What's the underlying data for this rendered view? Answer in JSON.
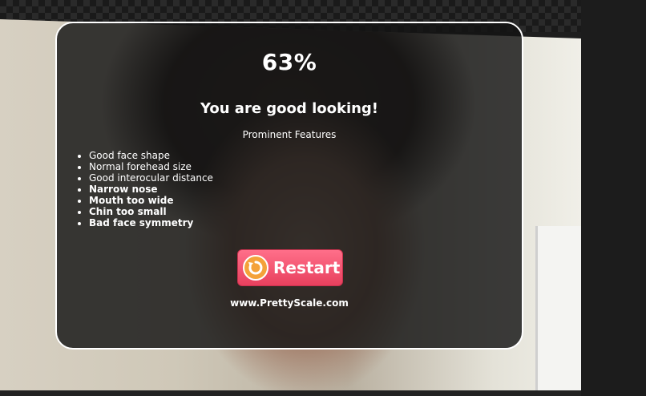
{
  "result": {
    "score": "63%",
    "verdict": "You are good looking!",
    "features_heading": "Prominent Features",
    "features": [
      {
        "text": "Good face shape",
        "positive": true
      },
      {
        "text": "Normal forehead size",
        "positive": true
      },
      {
        "text": "Good interocular distance",
        "positive": true
      },
      {
        "text": "Narrow nose",
        "positive": false
      },
      {
        "text": "Mouth too wide",
        "positive": false
      },
      {
        "text": "Chin too small",
        "positive": false
      },
      {
        "text": "Bad face symmetry",
        "positive": false
      }
    ],
    "restart_label": "Restart",
    "restart_icon": "restart-icon",
    "site_url": "www.PrettyScale.com"
  },
  "colors": {
    "card_background": "#141414",
    "card_border": "#ffffff",
    "button_top": "#ff6f8a",
    "button_bottom": "#e8405e",
    "icon_fill": "#f4a23a"
  }
}
